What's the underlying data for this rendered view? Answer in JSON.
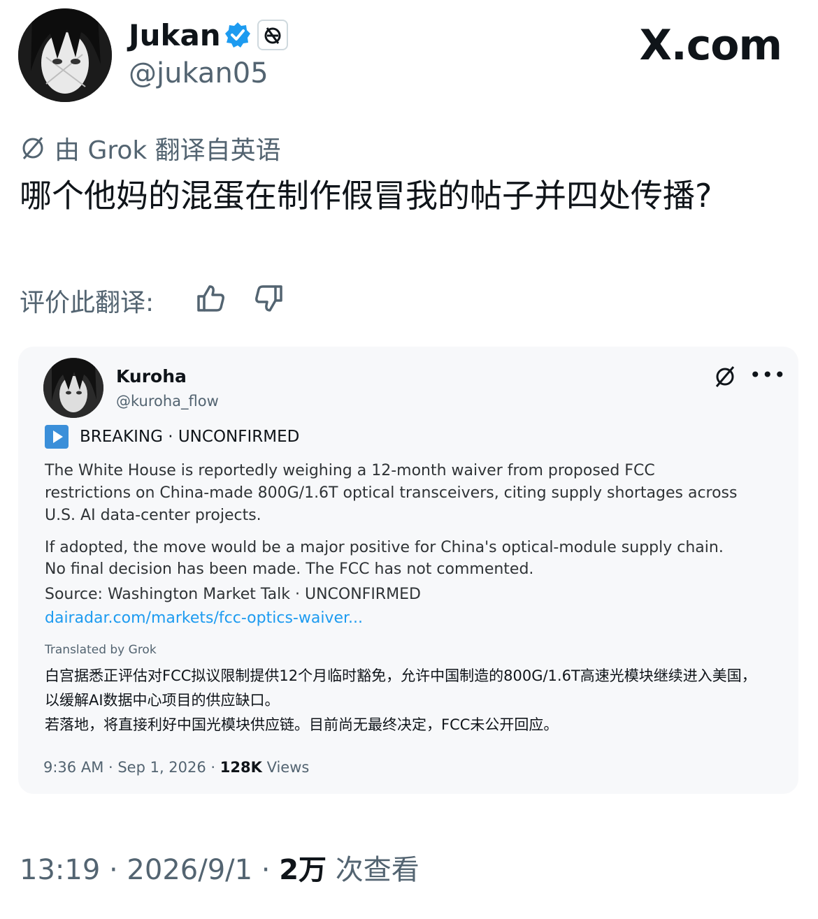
{
  "author": {
    "name": "Jukan",
    "handle": "@jukan05",
    "verified": true,
    "org_badge_icon": "grok-badge-icon"
  },
  "site_mark": "X.com",
  "translation": {
    "notice": "由 Grok 翻译自英语",
    "text": "哪个他妈的混蛋在制作假冒我的帖子并四处传播?",
    "rate_label": "评价此翻译:"
  },
  "embedded_post": {
    "name": "Kuroha",
    "handle": "@kuroha_flow",
    "tag": "BREAKING · UNCONFIRMED",
    "paragraph1": "The White House is reportedly weighing a 12-month waiver from proposed FCC restrictions on China-made 800G/1.6T optical transceivers, citing supply shortages across U.S. AI data-center projects.",
    "paragraph2": "If adopted, the move would be a major positive for China's optical-module supply chain. No final decision has been made. The FCC has not commented.",
    "source": "Source: Washington Market Talk  ·  UNCONFIRMED",
    "link": "dairadar.com/markets/fcc-optics-waiver...",
    "translated_by": "Translated by Grok",
    "translation_zh": "白宫据悉正评估对FCC拟议限制提供12个月临时豁免，允许中国制造的800G/1.6T高速光模块继续进入美国，以缓解AI数据中心项目的供应缺口。",
    "translation_zh2": "若落地，将直接利好中国光模块供应链。目前尚无最终决定，FCC未公开回应。",
    "time": "9:36 AM · Sep 1, 2026 · ",
    "views_count": "128K",
    "views_label": " Views"
  },
  "footer": {
    "time": "13:19 · 2026/9/1 · ",
    "views_count": "2万",
    "views_label": " 次查看"
  },
  "colors": {
    "accent": "#1d9bf0",
    "muted": "#536471",
    "card_bg": "#f7f8fa"
  }
}
